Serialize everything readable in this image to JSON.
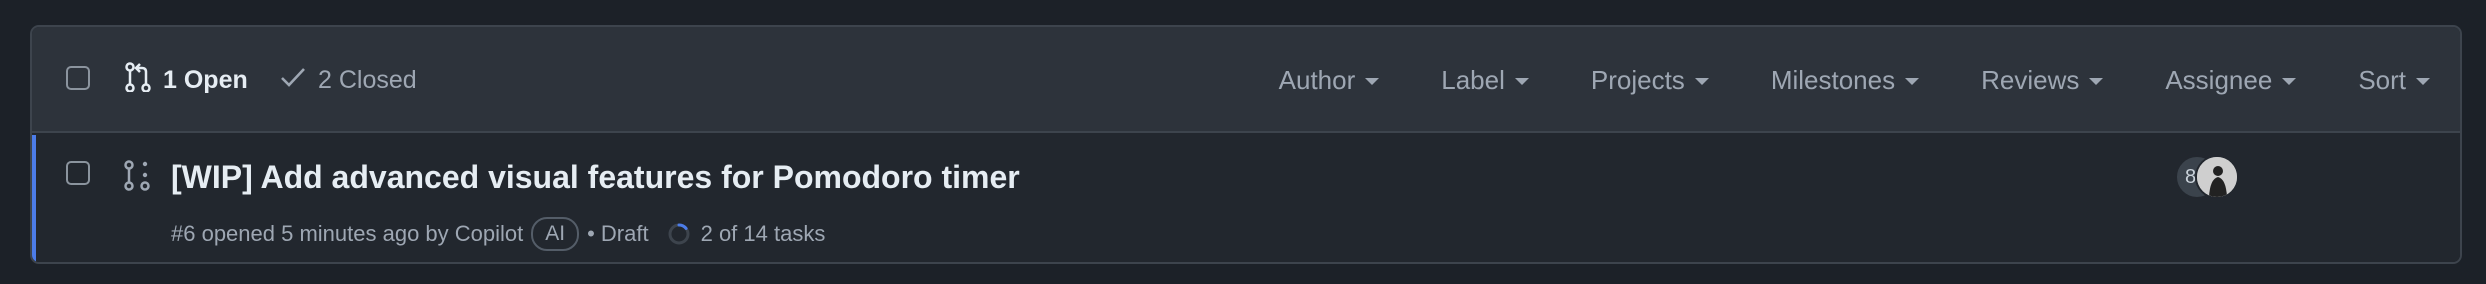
{
  "header": {
    "open_label": "1 Open",
    "closed_label": "2 Closed",
    "filters": [
      "Author",
      "Label",
      "Projects",
      "Milestones",
      "Reviews",
      "Assignee",
      "Sort"
    ]
  },
  "pull_request": {
    "title": "[WIP] Add advanced visual features for Pomodoro timer",
    "number_text": "#6 opened 5 minutes ago by Copilot",
    "author_badge": "AI",
    "status": "• Draft",
    "tasks": "2 of 14 tasks",
    "tasks_done": 2,
    "tasks_total": 14,
    "assignee_avatar_initial": "8"
  },
  "colors": {
    "accent": "#4c7ce8",
    "background": "#22272e",
    "header": "#2d333b"
  }
}
